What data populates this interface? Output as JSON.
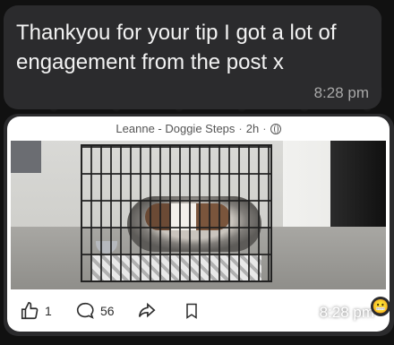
{
  "message": {
    "text": "Thankyou for your tip I got a lot of engagement from the post x",
    "time": "8:28 pm"
  },
  "shared_post": {
    "author": "Leanne - Doggie Steps",
    "separator": "·",
    "age": "2h",
    "visibility_icon": "globe-icon",
    "likes": "1",
    "comments": "56",
    "time": "8:28 pm",
    "reaction_emoji": "😬"
  },
  "colors": {
    "bubble": "#2b2b2d",
    "background": "#111111",
    "card": "#ffffff"
  }
}
